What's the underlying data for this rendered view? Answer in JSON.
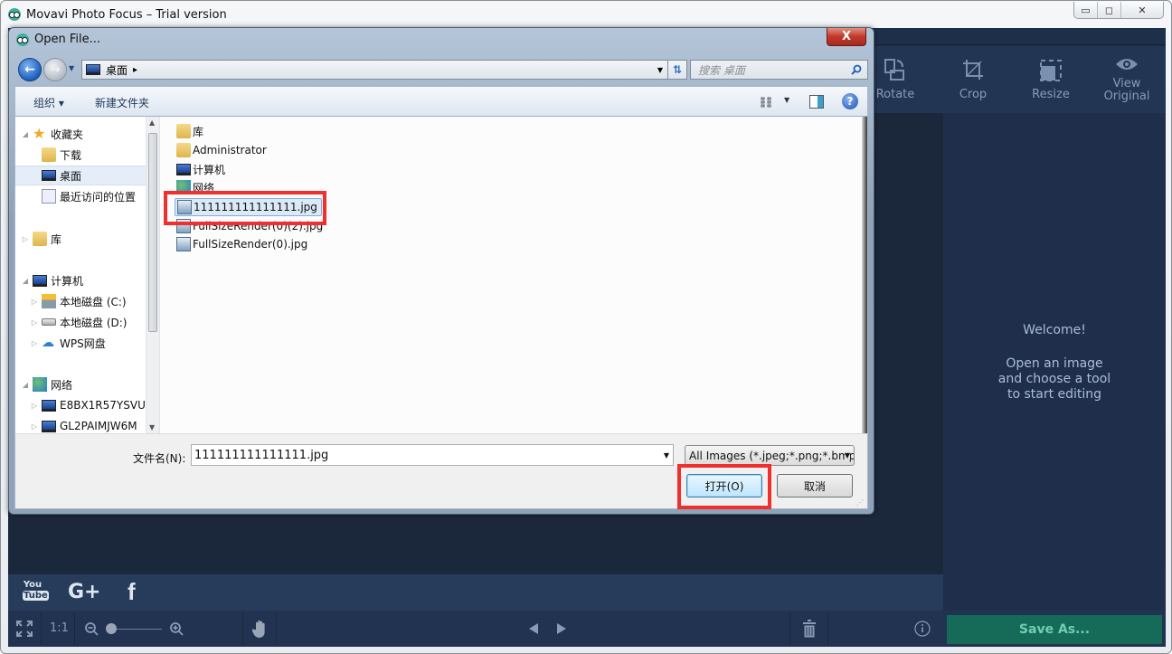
{
  "app": {
    "title": "Movavi Photo Focus – Trial version",
    "window_controls": {
      "minimize": "▭",
      "maximize": "◻",
      "close": "✕"
    },
    "tools": [
      {
        "id": "rotate",
        "label": "Rotate"
      },
      {
        "id": "crop",
        "label": "Crop"
      },
      {
        "id": "resize",
        "label": "Resize"
      },
      {
        "id": "view-original",
        "label": "View\nOriginal"
      }
    ],
    "welcome": {
      "heading": "Welcome!",
      "line1": "Open an image",
      "line2": "and choose a tool",
      "line3": "to start editing"
    },
    "social": {
      "youtube": "You Tube",
      "gplus": "G+",
      "facebook": "f"
    },
    "bottombar": {
      "ratio_label": "1:1",
      "zoom_level": 0,
      "save_label": "Save As...",
      "save_color": "#156b58"
    }
  },
  "dialog": {
    "title": "Open File...",
    "close_label": "X",
    "address": {
      "location": "桌面",
      "chevron": "▸"
    },
    "search": {
      "placeholder": "搜索 桌面"
    },
    "commands": {
      "organize": "组织 ▾",
      "new_folder": "新建文件夹"
    },
    "nav_tree": [
      {
        "label": "收藏夹",
        "level": 0,
        "icon": "star-icon",
        "expanded": true
      },
      {
        "label": "下载",
        "level": 1,
        "icon": "download-folder-icon"
      },
      {
        "label": "桌面",
        "level": 1,
        "icon": "desktop-icon",
        "selected": true
      },
      {
        "label": "最近访问的位置",
        "level": 1,
        "icon": "recent-places-icon"
      },
      {
        "label": "库",
        "level": 0,
        "icon": "library-icon",
        "expanded": false
      },
      {
        "label": "计算机",
        "level": 0,
        "icon": "computer-icon",
        "expanded": true
      },
      {
        "label": "本地磁盘 (C:)",
        "level": 1,
        "icon": "system-drive-icon"
      },
      {
        "label": "本地磁盘 (D:)",
        "level": 1,
        "icon": "drive-icon"
      },
      {
        "label": "WPS网盘",
        "level": 1,
        "icon": "cloud-icon"
      },
      {
        "label": "网络",
        "level": 0,
        "icon": "network-icon",
        "expanded": true
      },
      {
        "label": "E8BX1R57YSVU",
        "level": 1,
        "icon": "computer-icon"
      },
      {
        "label": "GL2PAIMJW6M",
        "level": 1,
        "icon": "computer-icon"
      }
    ],
    "files": [
      {
        "name": "库",
        "icon": "library-icon"
      },
      {
        "name": "Administrator",
        "icon": "user-folder-icon"
      },
      {
        "name": "计算机",
        "icon": "computer-icon"
      },
      {
        "name": "网络",
        "icon": "network-icon"
      },
      {
        "name": "111111111111111.jpg",
        "icon": "image-file-icon",
        "selected": true
      },
      {
        "name": "FullSizeRender(0)(2).jpg",
        "icon": "image-file-icon"
      },
      {
        "name": "FullSizeRender(0).jpg",
        "icon": "image-file-icon"
      }
    ],
    "filename_label": "文件名(N):",
    "filename_value": "111111111111111.jpg",
    "filter_value": "All Images (*.jpeg;*.png;*.bmp",
    "open_label": "打开(O)",
    "cancel_label": "取消",
    "highlight_color": "#f0302e"
  }
}
